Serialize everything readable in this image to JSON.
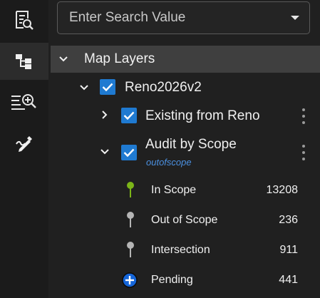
{
  "sidebar": {
    "items": [
      {
        "icon": "document-search-icon"
      },
      {
        "icon": "layer-tree-icon",
        "active": true
      },
      {
        "icon": "list-search-icon"
      },
      {
        "icon": "edit-pen-icon"
      }
    ]
  },
  "search": {
    "placeholder": "Enter Search Value"
  },
  "layers": {
    "header": "Map Layers",
    "group": {
      "label": "Reno2026v2",
      "children": [
        {
          "label": "Existing from Reno",
          "expanded": false
        },
        {
          "label": "Audit by Scope",
          "sublabel": "outofscope",
          "expanded": true,
          "legend": [
            {
              "label": "In Scope",
              "count": "13208",
              "color": "#7cb518"
            },
            {
              "label": "Out of Scope",
              "count": "236",
              "color": "#b5b5b5"
            },
            {
              "label": "Intersection",
              "count": "911",
              "color": "#b5b5b5"
            },
            {
              "label": "Pending",
              "count": "441",
              "color": "#1565d8"
            }
          ]
        }
      ]
    }
  },
  "colors": {
    "accent": "#1f7ad1",
    "header_bg": "#3f3f3f",
    "sublabel": "#4b90e0"
  }
}
